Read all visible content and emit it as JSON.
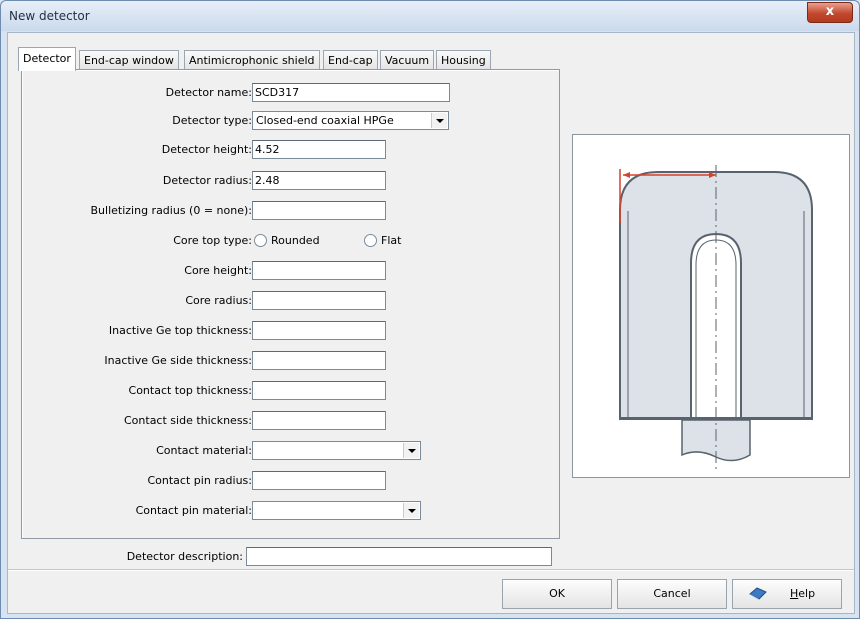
{
  "window": {
    "title": "New detector",
    "close_label": "x"
  },
  "tabs": [
    {
      "label": "Detector"
    },
    {
      "label": "End-cap window"
    },
    {
      "label": "Antimicrophonic shield"
    },
    {
      "label": "End-cap"
    },
    {
      "label": "Vacuum"
    },
    {
      "label": "Housing"
    }
  ],
  "form": {
    "detector_name": {
      "label": "Detector name:",
      "value": "SCD317"
    },
    "detector_type": {
      "label": "Detector type:",
      "value": "Closed-end coaxial HPGe"
    },
    "detector_height": {
      "label": "Detector height:",
      "value": "4.52"
    },
    "detector_radius": {
      "label": "Detector radius:",
      "value": "2.48"
    },
    "bulletizing_radius": {
      "label": "Bulletizing radius (0 = none):",
      "value": ""
    },
    "core_top_type": {
      "label": "Core top type:",
      "options": [
        "Rounded",
        "Flat"
      ],
      "selected": ""
    },
    "core_height": {
      "label": "Core height:",
      "value": ""
    },
    "core_radius": {
      "label": "Core radius:",
      "value": ""
    },
    "inactive_ge_top": {
      "label": "Inactive Ge top thickness:",
      "value": ""
    },
    "inactive_ge_side": {
      "label": "Inactive Ge side thickness:",
      "value": ""
    },
    "contact_top": {
      "label": "Contact top thickness:",
      "value": ""
    },
    "contact_side": {
      "label": "Contact side thickness:",
      "value": ""
    },
    "contact_material": {
      "label": "Contact material:",
      "value": ""
    },
    "contact_pin_radius": {
      "label": "Contact pin radius:",
      "value": ""
    },
    "contact_pin_material": {
      "label": "Contact pin material:",
      "value": ""
    }
  },
  "description": {
    "label": "Detector description:",
    "value": ""
  },
  "buttons": {
    "ok": "OK",
    "cancel": "Cancel",
    "help_first": "H",
    "help_rest": "elp"
  },
  "colors": {
    "accent_red": "#d9412b",
    "detector_fill": "#dde2e8",
    "detector_stroke": "#59636e"
  }
}
